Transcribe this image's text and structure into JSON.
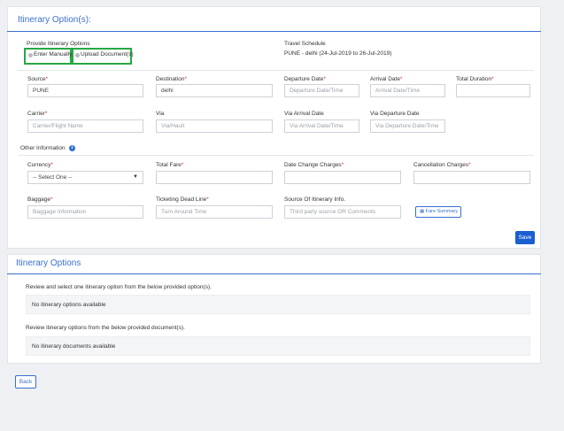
{
  "section1": {
    "title": "Itinerary Option(s):",
    "provide_label": "Provide Itinerary Options",
    "enter_manually": "Enter Manually",
    "upload_documents": "Upload Document(s)",
    "travel_schedule_label": "Travel Schedule",
    "travel_schedule_value": "PUNE - delhi (24-Jul-2019 to 26-Jul-2019)",
    "source": {
      "label": "Source",
      "value": "PUNE"
    },
    "destination": {
      "label": "Destination",
      "value": "delhi"
    },
    "departure_date": {
      "label": "Departure Date",
      "placeholder": "Departure Date/Time"
    },
    "arrival_date": {
      "label": "Arrival Date",
      "placeholder": "Arrival Date/Time"
    },
    "total_duration": {
      "label": "Total Duration",
      "value": ""
    },
    "carrier": {
      "label": "Carrier",
      "placeholder": "Carrier/Flight Name"
    },
    "via": {
      "label": "Via",
      "placeholder": "Via/Hault"
    },
    "via_arrival_date": {
      "label": "Via Arrival Date",
      "placeholder": "Via Arrival Date/Time"
    },
    "via_departure_date": {
      "label": "Via Departure Date",
      "placeholder": "Via Departure Date/Time"
    },
    "other_information": "Other Information",
    "currency": {
      "label": "Currency",
      "value": "-- Select One --"
    },
    "total_fare": {
      "label": "Total Fare",
      "value": ""
    },
    "date_change_charges": {
      "label": "Date Change Charges",
      "value": ""
    },
    "cancellation_charges": {
      "label": "Cancellation Charges",
      "value": ""
    },
    "baggage": {
      "label": "Baggage",
      "placeholder": "Baggage Information"
    },
    "ticketing_deadline": {
      "label": "Ticketing Dead Line",
      "placeholder": "Turn Around Time"
    },
    "source_of_itinerary": {
      "label": "Source Of Itinerary Info.",
      "placeholder": "Third party source OR Comments"
    },
    "fare_summary": "Fare Summary",
    "save": "Save"
  },
  "section2": {
    "title": "Itinerary Options",
    "review_options_text": "Review and select one itinerary option from the below provided option(s).",
    "no_options": "No itinerary options available",
    "review_documents_text": "Review itinerary options from the below provided document(s).",
    "no_documents": "No itinerary documents available"
  },
  "back": "Back",
  "colors": {
    "accent": "#3a6fd0",
    "save_button": "#1a5fd0",
    "highlight": "#27a844",
    "required": "#d33"
  },
  "icons": {
    "info": "info-icon",
    "fare_summary": "table-icon",
    "currency_dropdown": "chevron-down-icon"
  }
}
